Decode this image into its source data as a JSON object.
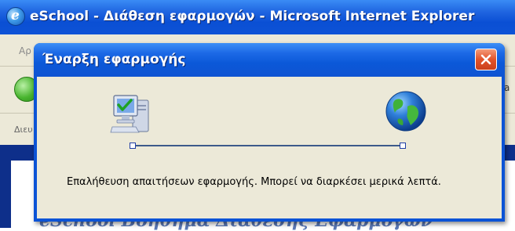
{
  "browser": {
    "title": "eSchool - Διάθεση εφαρμογών - Microsoft Internet Explorer",
    "menu_fragment": "Αρ",
    "toolbar_fragment": "a",
    "address_fragment": "Διευ",
    "content_fragment": "eSchool Βοήθημα Διάθεσης Εφαρμογών"
  },
  "dialog": {
    "title": "Έναρξη εφαρμογής",
    "status_message": "Επαλήθευση απαιτήσεων εφαρμογής. Μπορεί να διαρκέσει μερικά λεπτά."
  },
  "icons": {
    "browser": "internet-explorer-icon",
    "back": "back-arrow-icon",
    "close": "close-icon",
    "source": "computer-check-icon",
    "destination": "globe-icon"
  },
  "colors": {
    "titlebar": "#0b53d6",
    "dialog_bg": "#ece9d8",
    "close_button": "#e2532a",
    "content_banner": "#0e2f8a"
  }
}
